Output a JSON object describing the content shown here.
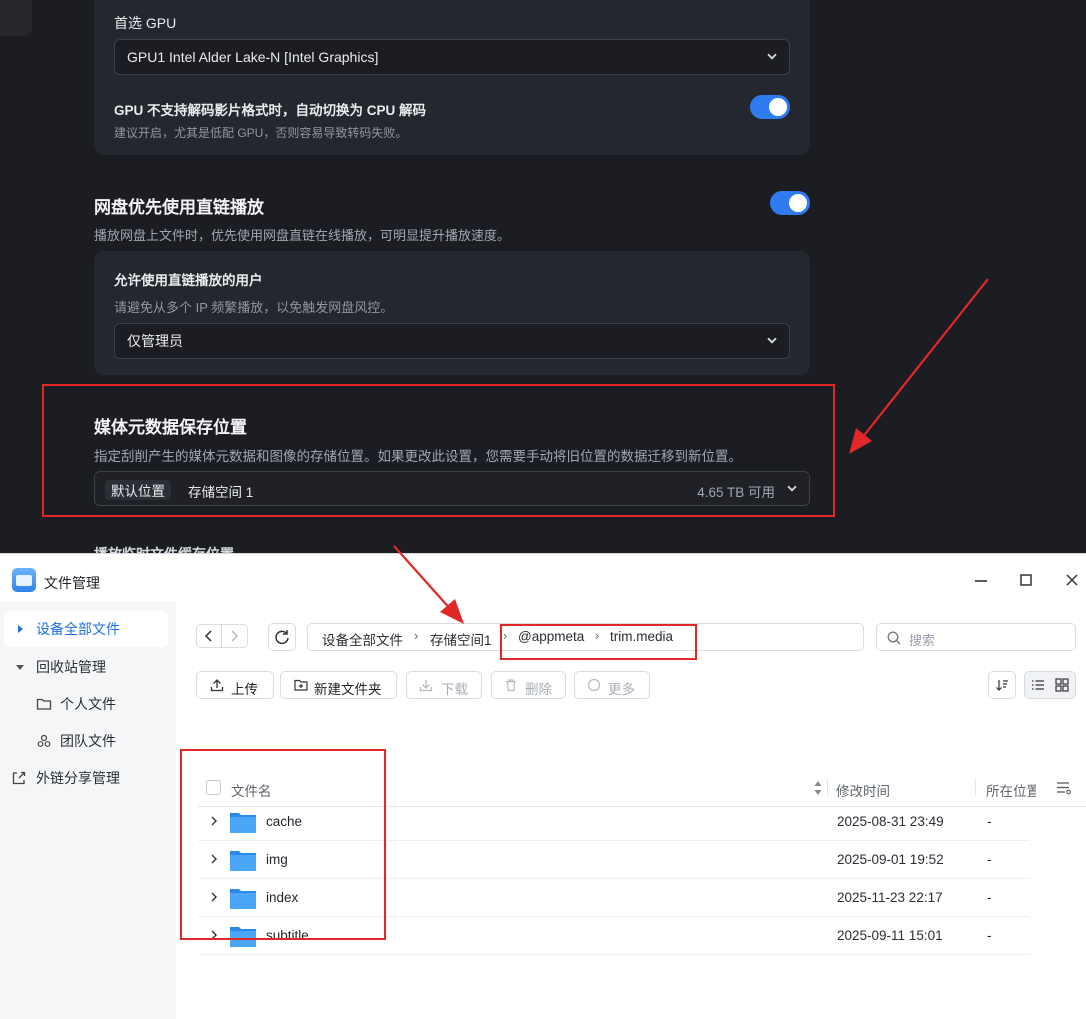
{
  "settings": {
    "gpu_label": "首选 GPU",
    "gpu_value": "GPU1 Intel Alder Lake-N [Intel Graphics]",
    "fallback_title": "GPU 不支持解码影片格式时，自动切换为 CPU 解码",
    "fallback_desc": "建议开启，尤其是低配 GPU，否则容易导致转码失败。",
    "fallback_on": true,
    "direct_title": "网盘优先使用直链播放",
    "direct_desc": "播放网盘上文件时，优先使用网盘直链在线播放，可明显提升播放速度。",
    "direct_on": true,
    "allowed_users_label": "允许使用直链播放的用户",
    "allowed_users_desc": "请避免从多个 IP 频繁播放，以免触发网盘风控。",
    "allowed_users_value": "仅管理员",
    "meta_title": "媒体元数据保存位置",
    "meta_desc": "指定刮削产生的媒体元数据和图像的存储位置。如果更改此设置，您需要手动将旧位置的数据迁移到新位置。",
    "meta_default_tag": "默认位置",
    "meta_storage": "存储空间 1",
    "meta_free": "4.65 TB 可用",
    "next_title": "播放临时文件缓存位置"
  },
  "file_manager": {
    "title": "文件管理",
    "sidebar": [
      {
        "label": "设备全部文件",
        "icon": "caret-right-icon"
      },
      {
        "label": "回收站管理",
        "icon": "caret-down-icon"
      },
      {
        "label": "个人文件",
        "icon": "folder-outline-icon"
      },
      {
        "label": "团队文件",
        "icon": "team-icon"
      },
      {
        "label": "外链分享管理",
        "icon": "share-icon"
      }
    ],
    "breadcrumb": [
      "设备全部文件",
      "存储空间1",
      "@appmeta",
      "trim.media"
    ],
    "search_placeholder": "搜索",
    "toolbar": {
      "upload": "上传",
      "new_folder": "新建文件夹",
      "download": "下载",
      "delete": "删除",
      "more": "更多"
    },
    "columns": {
      "name": "文件名",
      "modified": "修改时间",
      "location": "所在位置"
    },
    "files": [
      {
        "name": "cache",
        "modified": "2025-08-31 23:49",
        "location": "-"
      },
      {
        "name": "img",
        "modified": "2025-09-01 19:52",
        "location": "-"
      },
      {
        "name": "index",
        "modified": "2025-11-23 22:17",
        "location": "-"
      },
      {
        "name": "subtitle",
        "modified": "2025-09-11 15:01",
        "location": "-"
      }
    ]
  },
  "colors": {
    "accent": "#2f7bf0",
    "annotation": "#e02828",
    "folder": "#3d97f2"
  }
}
